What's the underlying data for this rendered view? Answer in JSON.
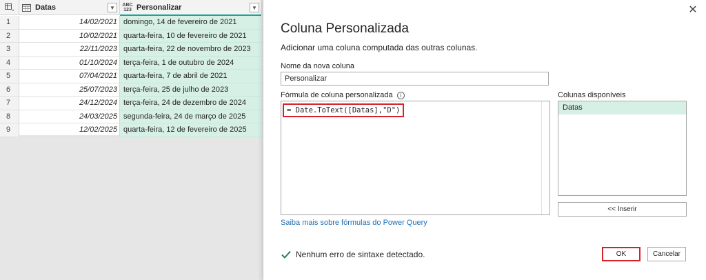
{
  "grid": {
    "columns": [
      {
        "name": "Datas",
        "type_icon": "calendar-icon"
      },
      {
        "name": "Personalizar",
        "type_icon": "abc-123-icon",
        "type_text": "ABC\n123"
      }
    ],
    "rows": [
      {
        "num": "1",
        "date": "14/02/2021",
        "text": "domingo, 14 de fevereiro de 2021"
      },
      {
        "num": "2",
        "date": "10/02/2021",
        "text": "quarta-feira, 10 de fevereiro de 2021"
      },
      {
        "num": "3",
        "date": "22/11/2023",
        "text": "quarta-feira, 22 de novembro de 2023"
      },
      {
        "num": "4",
        "date": "01/10/2024",
        "text": "terça-feira, 1 de outubro de 2024"
      },
      {
        "num": "5",
        "date": "07/04/2021",
        "text": "quarta-feira, 7 de abril de 2021"
      },
      {
        "num": "6",
        "date": "25/07/2023",
        "text": "terça-feira, 25 de julho de 2023"
      },
      {
        "num": "7",
        "date": "24/12/2024",
        "text": "terça-feira, 24 de dezembro de 2024"
      },
      {
        "num": "8",
        "date": "24/03/2025",
        "text": "segunda-feira, 24 de março de 2025"
      },
      {
        "num": "9",
        "date": "12/02/2025",
        "text": "quarta-feira, 12 de fevereiro de 2025"
      }
    ],
    "accent_color": "#1aa596",
    "selected_col_bg": "#d6f0e6"
  },
  "dialog": {
    "title": "Coluna Personalizada",
    "subtitle": "Adicionar uma coluna computada das outras colunas.",
    "name_label": "Nome da nova coluna",
    "name_value": "Personalizar",
    "formula_label": "Fórmula de coluna personalizada",
    "formula": "= Date.ToText([Datas],\"D\")",
    "columns_label": "Colunas disponíveis",
    "available_columns": [
      "Datas"
    ],
    "insert_button": "<< Inserir",
    "learn_link": "Saiba mais sobre fórmulas do Power Query",
    "status": "Nenhum erro de sintaxe detectado.",
    "ok_button": "OK",
    "cancel_button": "Cancelar",
    "close_icon": "close-icon",
    "highlight_color": "#d9202a"
  }
}
